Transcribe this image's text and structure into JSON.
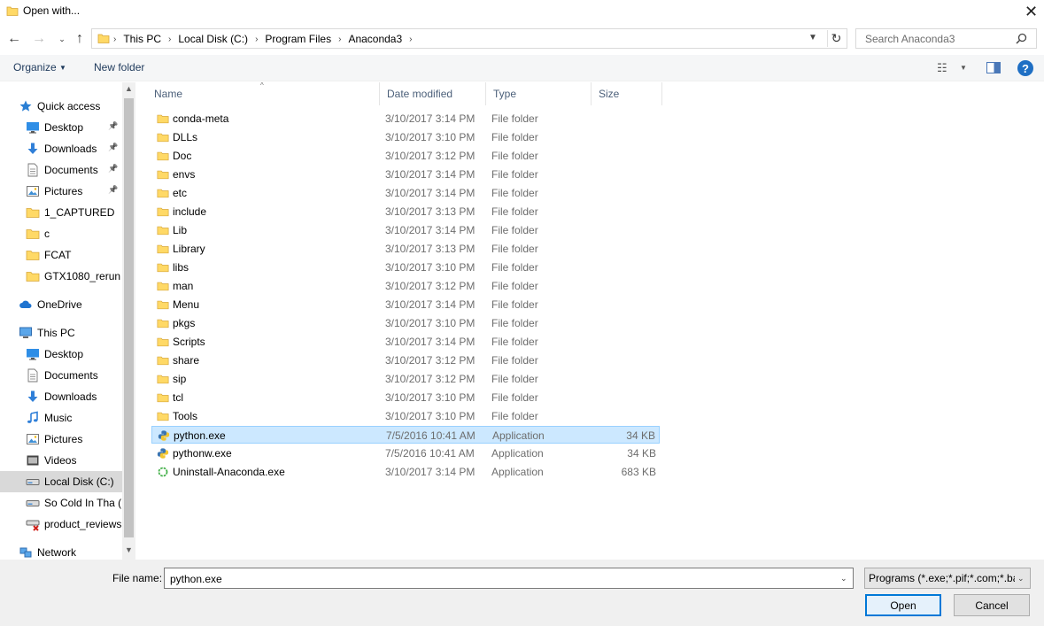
{
  "window": {
    "title": "Open with..."
  },
  "nav": {
    "breadcrumbs": [
      "This PC",
      "Local Disk (C:)",
      "Program Files",
      "Anaconda3"
    ],
    "search_placeholder": "Search Anaconda3"
  },
  "toolbar": {
    "organize": "Organize",
    "new_folder": "New folder"
  },
  "sidebar": {
    "items": [
      {
        "label": "Quick access",
        "icon": "star-icon",
        "indent": 0,
        "pinned": false
      },
      {
        "label": "Desktop",
        "icon": "desktop-icon",
        "indent": 1,
        "pinned": true
      },
      {
        "label": "Downloads",
        "icon": "download-icon",
        "indent": 1,
        "pinned": true
      },
      {
        "label": "Documents",
        "icon": "document-icon",
        "indent": 1,
        "pinned": true
      },
      {
        "label": "Pictures",
        "icon": "pictures-icon",
        "indent": 1,
        "pinned": true
      },
      {
        "label": "1_CAPTURED",
        "icon": "folder-icon",
        "indent": 1,
        "pinned": false
      },
      {
        "label": "c",
        "icon": "folder-icon",
        "indent": 1,
        "pinned": false
      },
      {
        "label": "FCAT",
        "icon": "folder-icon",
        "indent": 1,
        "pinned": false
      },
      {
        "label": "GTX1080_rerun",
        "icon": "folder-icon",
        "indent": 1,
        "pinned": false
      },
      {
        "label": "OneDrive",
        "icon": "cloud-icon",
        "indent": 0,
        "pinned": false
      },
      {
        "label": "This PC",
        "icon": "computer-icon",
        "indent": 0,
        "pinned": false
      },
      {
        "label": "Desktop",
        "icon": "desktop-icon",
        "indent": 1,
        "pinned": false
      },
      {
        "label": "Documents",
        "icon": "document-icon",
        "indent": 1,
        "pinned": false
      },
      {
        "label": "Downloads",
        "icon": "download-icon",
        "indent": 1,
        "pinned": false
      },
      {
        "label": "Music",
        "icon": "music-icon",
        "indent": 1,
        "pinned": false
      },
      {
        "label": "Pictures",
        "icon": "pictures-icon",
        "indent": 1,
        "pinned": false
      },
      {
        "label": "Videos",
        "icon": "video-icon",
        "indent": 1,
        "pinned": false
      },
      {
        "label": "Local Disk (C:)",
        "icon": "drive-icon",
        "indent": 1,
        "pinned": false,
        "selected": true
      },
      {
        "label": "So Cold In Tha (I",
        "icon": "drive-icon",
        "indent": 1,
        "pinned": false
      },
      {
        "label": "product_reviews",
        "icon": "network-drive-icon",
        "indent": 1,
        "pinned": false
      },
      {
        "label": "Network",
        "icon": "network-icon",
        "indent": 0,
        "pinned": false
      }
    ]
  },
  "columns": {
    "name": "Name",
    "date": "Date modified",
    "type": "Type",
    "size": "Size"
  },
  "files": [
    {
      "name": "conda-meta",
      "date": "3/10/2017 3:14 PM",
      "type": "File folder",
      "size": "",
      "icon": "folder-icon"
    },
    {
      "name": "DLLs",
      "date": "3/10/2017 3:10 PM",
      "type": "File folder",
      "size": "",
      "icon": "folder-icon"
    },
    {
      "name": "Doc",
      "date": "3/10/2017 3:12 PM",
      "type": "File folder",
      "size": "",
      "icon": "folder-icon"
    },
    {
      "name": "envs",
      "date": "3/10/2017 3:14 PM",
      "type": "File folder",
      "size": "",
      "icon": "folder-icon"
    },
    {
      "name": "etc",
      "date": "3/10/2017 3:14 PM",
      "type": "File folder",
      "size": "",
      "icon": "folder-icon"
    },
    {
      "name": "include",
      "date": "3/10/2017 3:13 PM",
      "type": "File folder",
      "size": "",
      "icon": "folder-icon"
    },
    {
      "name": "Lib",
      "date": "3/10/2017 3:14 PM",
      "type": "File folder",
      "size": "",
      "icon": "folder-icon"
    },
    {
      "name": "Library",
      "date": "3/10/2017 3:13 PM",
      "type": "File folder",
      "size": "",
      "icon": "folder-icon"
    },
    {
      "name": "libs",
      "date": "3/10/2017 3:10 PM",
      "type": "File folder",
      "size": "",
      "icon": "folder-icon"
    },
    {
      "name": "man",
      "date": "3/10/2017 3:12 PM",
      "type": "File folder",
      "size": "",
      "icon": "folder-icon"
    },
    {
      "name": "Menu",
      "date": "3/10/2017 3:14 PM",
      "type": "File folder",
      "size": "",
      "icon": "folder-icon"
    },
    {
      "name": "pkgs",
      "date": "3/10/2017 3:10 PM",
      "type": "File folder",
      "size": "",
      "icon": "folder-icon"
    },
    {
      "name": "Scripts",
      "date": "3/10/2017 3:14 PM",
      "type": "File folder",
      "size": "",
      "icon": "folder-icon"
    },
    {
      "name": "share",
      "date": "3/10/2017 3:12 PM",
      "type": "File folder",
      "size": "",
      "icon": "folder-icon"
    },
    {
      "name": "sip",
      "date": "3/10/2017 3:12 PM",
      "type": "File folder",
      "size": "",
      "icon": "folder-icon"
    },
    {
      "name": "tcl",
      "date": "3/10/2017 3:10 PM",
      "type": "File folder",
      "size": "",
      "icon": "folder-icon"
    },
    {
      "name": "Tools",
      "date": "3/10/2017 3:10 PM",
      "type": "File folder",
      "size": "",
      "icon": "folder-icon"
    },
    {
      "name": "python.exe",
      "date": "7/5/2016 10:41 AM",
      "type": "Application",
      "size": "34 KB",
      "icon": "python-icon",
      "selected": true
    },
    {
      "name": "pythonw.exe",
      "date": "7/5/2016 10:41 AM",
      "type": "Application",
      "size": "34 KB",
      "icon": "python-icon"
    },
    {
      "name": "Uninstall-Anaconda.exe",
      "date": "3/10/2017 3:14 PM",
      "type": "Application",
      "size": "683 KB",
      "icon": "anaconda-icon"
    }
  ],
  "footer": {
    "file_name_label": "File name:",
    "file_name_value": "python.exe",
    "filter": "Programs (*.exe;*.pif;*.com;*.bat;*.cmd)",
    "open": "Open",
    "cancel": "Cancel"
  },
  "colors": {
    "selection": "#cce8ff",
    "accent": "#0078d7",
    "folder": "#ffd966"
  }
}
